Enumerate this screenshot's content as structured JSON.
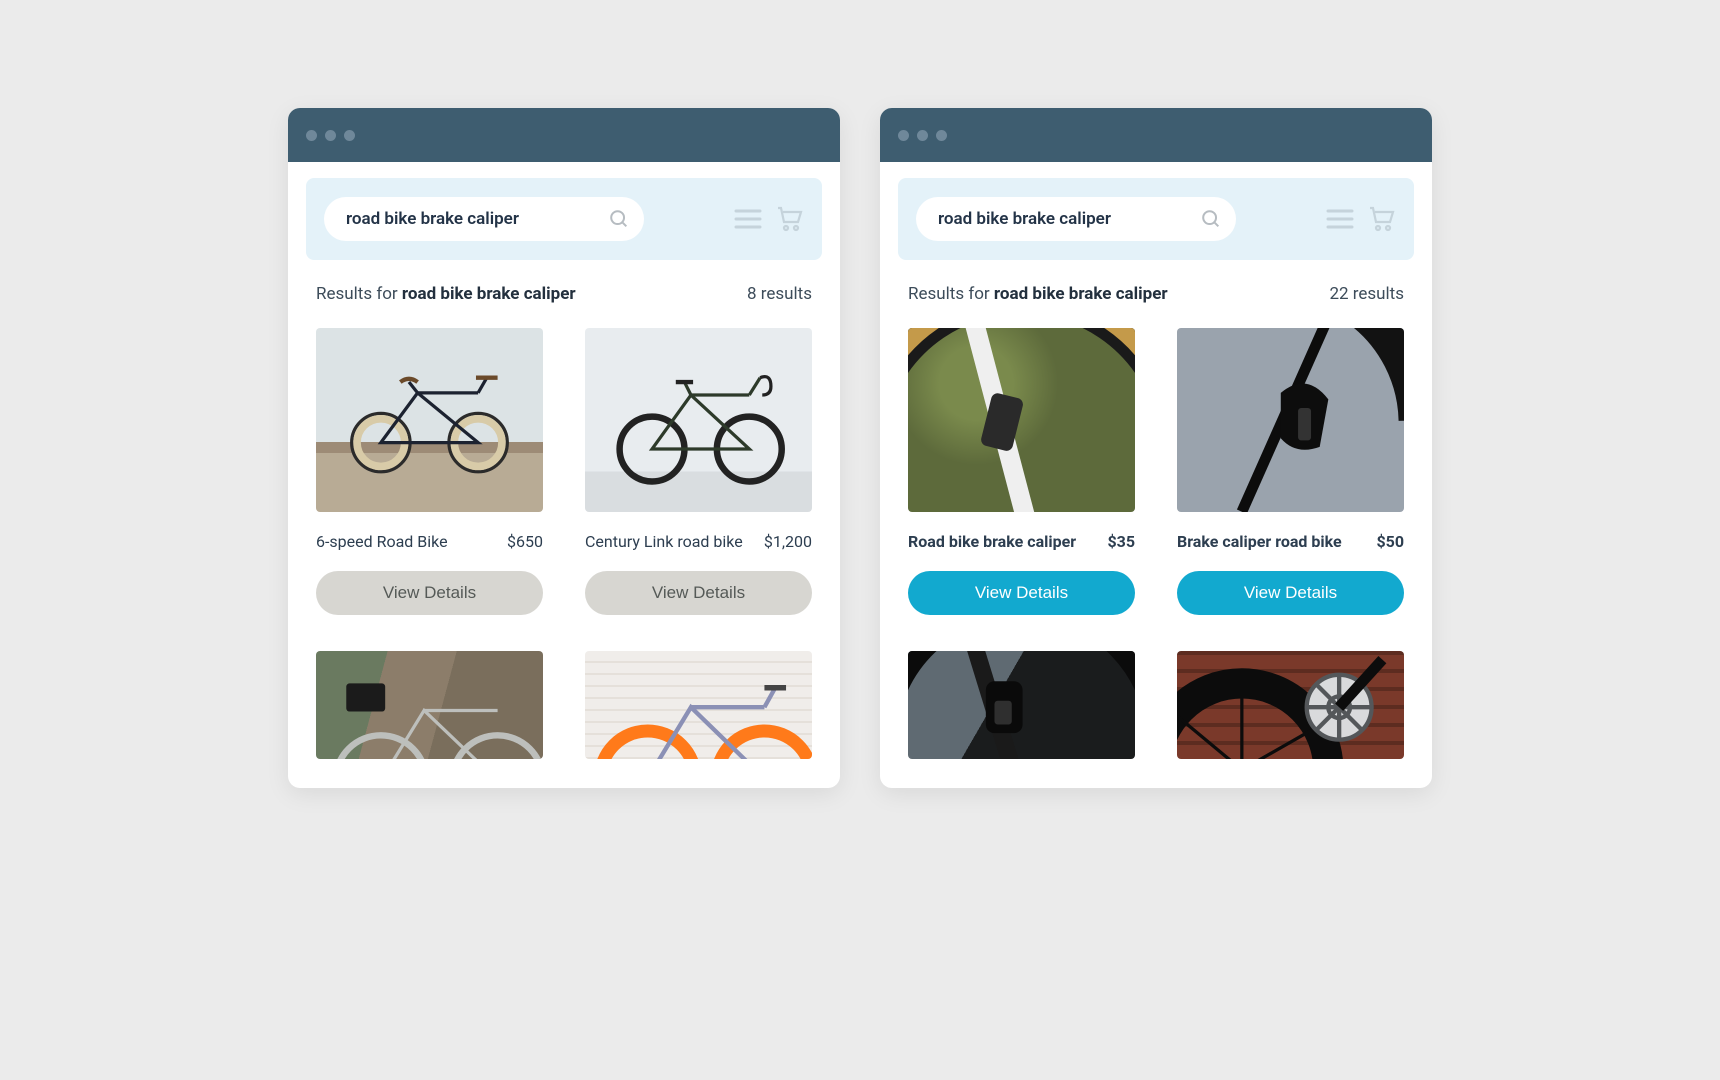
{
  "left": {
    "search_query": "road bike brake caliper",
    "results_prefix": "Results for",
    "results_query": "road bike brake caliper",
    "results_count": "8 results",
    "cards": [
      {
        "title": "6-speed Road Bike",
        "price": "$650",
        "button": "View Details"
      },
      {
        "title": "Century Link road bike",
        "price": "$1,200",
        "button": "View Details"
      }
    ]
  },
  "right": {
    "search_query": "road bike brake caliper",
    "results_prefix": "Results for",
    "results_query": "road bike brake caliper",
    "results_count": "22 results",
    "cards": [
      {
        "title": "Road bike brake caliper",
        "price": "$35",
        "button": "View Details"
      },
      {
        "title": "Brake caliper road bike",
        "price": "$50",
        "button": "View Details"
      }
    ]
  },
  "colors": {
    "teal": "#12a9cf",
    "grey_btn": "#d7d6d1",
    "titlebar": "#3e5d70",
    "header_strip": "#e4f2f9"
  }
}
